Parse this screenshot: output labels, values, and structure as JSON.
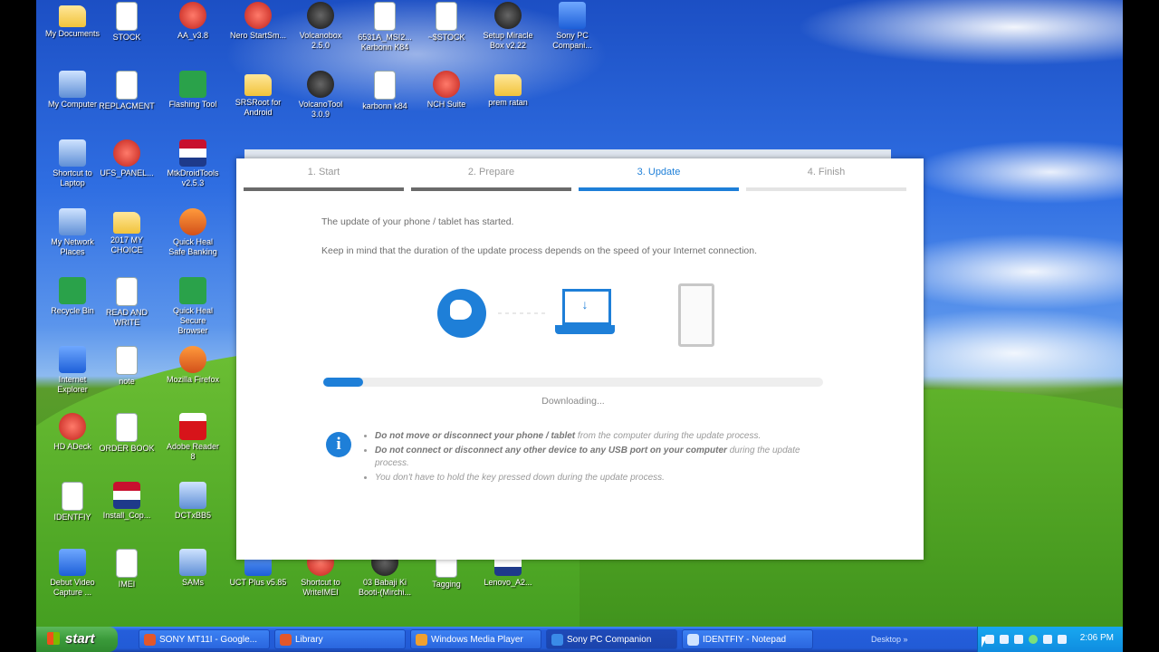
{
  "desktop_icons": [
    {
      "label": "My Documents",
      "kind": "folder"
    },
    {
      "label": "STOCK",
      "kind": "doc"
    },
    {
      "label": "AA_v3.8",
      "kind": "red"
    },
    {
      "label": "Nero StartSm...",
      "kind": "red"
    },
    {
      "label": "Volcanobox 2.5.0",
      "kind": "dark"
    },
    {
      "label": "6531A_MSI2... Karbonn K84",
      "kind": "doc"
    },
    {
      "label": "~$STOCK",
      "kind": "doc"
    },
    {
      "label": "Setup Miracle Box v2.22",
      "kind": "dark"
    },
    {
      "label": "Sony PC Compani...",
      "kind": "blue"
    },
    {
      "label": "My Computer",
      "kind": "pc"
    },
    {
      "label": "REPLACMENT",
      "kind": "doc"
    },
    {
      "label": "Flashing Tool",
      "kind": "green"
    },
    {
      "label": "SRSRoot for Android",
      "kind": "folder"
    },
    {
      "label": "VolcanoTool 3.0.9",
      "kind": "dark"
    },
    {
      "label": "karbonn k84",
      "kind": "doc"
    },
    {
      "label": "NCH Suite",
      "kind": "red"
    },
    {
      "label": "prem ratan",
      "kind": "folder"
    },
    {
      "label": "Shortcut to Laptop",
      "kind": "pc"
    },
    {
      "label": "UFS_PANEL...",
      "kind": "red"
    },
    {
      "label": "MtkDroidTools v2.5.3",
      "kind": "flag"
    },
    {
      "label": "My Network Places",
      "kind": "pc"
    },
    {
      "label": "2017 MY CHOICE",
      "kind": "folder"
    },
    {
      "label": "Quick Heal Safe Banking",
      "kind": "orange"
    },
    {
      "label": "Recycle Bin",
      "kind": "green"
    },
    {
      "label": "READ AND WRITE",
      "kind": "doc"
    },
    {
      "label": "Quick Heal Secure Browser",
      "kind": "green"
    },
    {
      "label": "Internet Explorer",
      "kind": "blue"
    },
    {
      "label": "note",
      "kind": "doc"
    },
    {
      "label": "Mozilla Firefox",
      "kind": "orange"
    },
    {
      "label": "HD ADeck",
      "kind": "red"
    },
    {
      "label": "ORDER BOOK",
      "kind": "doc"
    },
    {
      "label": "Adobe Reader 8",
      "kind": "pdf"
    },
    {
      "label": "IDENTFIY",
      "kind": "doc"
    },
    {
      "label": "Install_Cop...",
      "kind": "flag"
    },
    {
      "label": "DCTxBB5",
      "kind": "pc"
    },
    {
      "label": "Debut Video Capture ...",
      "kind": "blue"
    },
    {
      "label": "IMEI",
      "kind": "doc"
    },
    {
      "label": "SAMs",
      "kind": "pc"
    },
    {
      "label": "UCT Plus v5.85",
      "kind": "blue"
    },
    {
      "label": "Shortcut to WriteIMEI",
      "kind": "red"
    },
    {
      "label": "03 Babaji Ki Booti-(Mirchi...",
      "kind": "dark"
    },
    {
      "label": "Tagging",
      "kind": "doc"
    },
    {
      "label": "Lenovo_A2...",
      "kind": "flag"
    }
  ],
  "companion": {
    "steps": [
      {
        "label": "1. Start",
        "state": "done"
      },
      {
        "label": "2. Prepare",
        "state": "done"
      },
      {
        "label": "3. Update",
        "state": "active"
      },
      {
        "label": "4. Finish",
        "state": "pending"
      }
    ],
    "line1": "The update of your phone / tablet has started.",
    "line2": "Keep in mind that the duration of the update process depends on the speed of your Internet connection.",
    "progress_fraction": 0.08,
    "status": "Downloading...",
    "notes": [
      {
        "bold": "Do not move or disconnect your phone / tablet",
        "rest": " from the computer during the update process."
      },
      {
        "bold": "Do not connect or disconnect any other device to any USB port on your computer",
        "rest": " during the update process."
      },
      {
        "bold": "",
        "rest": "You don't have to hold the key pressed down during the update process."
      }
    ],
    "info_glyph": "i",
    "download_glyph": "↓"
  },
  "taskbar": {
    "start_label": "start",
    "tasks": [
      {
        "label": "SONY MT11I - Google...",
        "color": "#e2572b"
      },
      {
        "label": "Library",
        "color": "#e2572b"
      },
      {
        "label": "Windows Media Player",
        "color": "#f0a030"
      },
      {
        "label": "Sony PC Companion",
        "color": "#3a8be8"
      },
      {
        "label": "IDENTFIY - Notepad",
        "color": "#cfe3ff"
      }
    ],
    "desktop_label": "Desktop »",
    "clock": "2:06 PM"
  },
  "colors": {
    "accent": "#1e7fd8",
    "taskbar": "#245edb",
    "start": "#3a9a3a"
  }
}
